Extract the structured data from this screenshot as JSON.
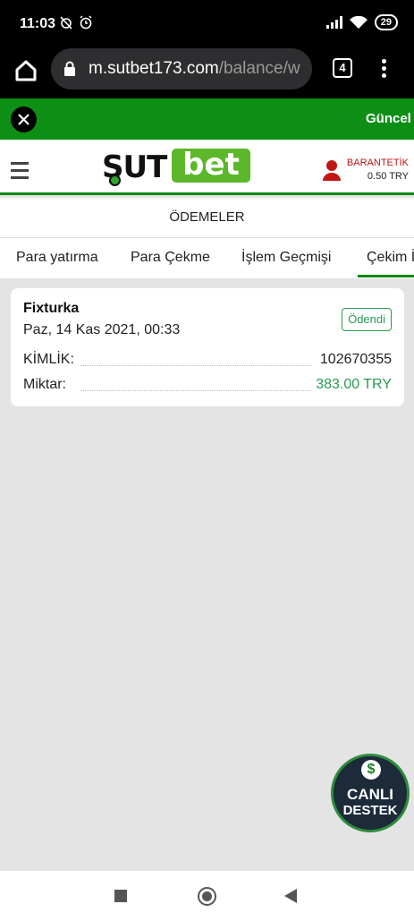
{
  "status": {
    "time": "11:03",
    "battery": "29"
  },
  "browser": {
    "url_host": "m.sutbet173.com",
    "url_path": "/balance/w",
    "tab_count": "4"
  },
  "banner": {
    "text": "Güncel g"
  },
  "site": {
    "logo_left": "ŞUT",
    "logo_right": "bet",
    "user_name": "BARANTETİK",
    "user_balance": "0.50 TRY",
    "page_title": "ÖDEMELER"
  },
  "tabs": [
    {
      "label": "Para yatırma"
    },
    {
      "label": "Para Çekme"
    },
    {
      "label": "İşlem Geçmişi"
    },
    {
      "label": "Çekim İ"
    }
  ],
  "card": {
    "title": "Fixturka",
    "date": "Paz, 14 Kas 2021, 00:33",
    "status": "Ödendi",
    "id_label": "KİMLİK:",
    "id_value": "102670355",
    "amount_label": "Miktar:",
    "amount_value": "383.00 TRY"
  },
  "support": {
    "line1": "CANLI",
    "line2": "DESTEK",
    "symbol": "$"
  },
  "colors": {
    "brand_green": "#0b8a14",
    "logo_green": "#5cb82a",
    "paid_green": "#2a9a52",
    "user_red": "#c01515"
  }
}
